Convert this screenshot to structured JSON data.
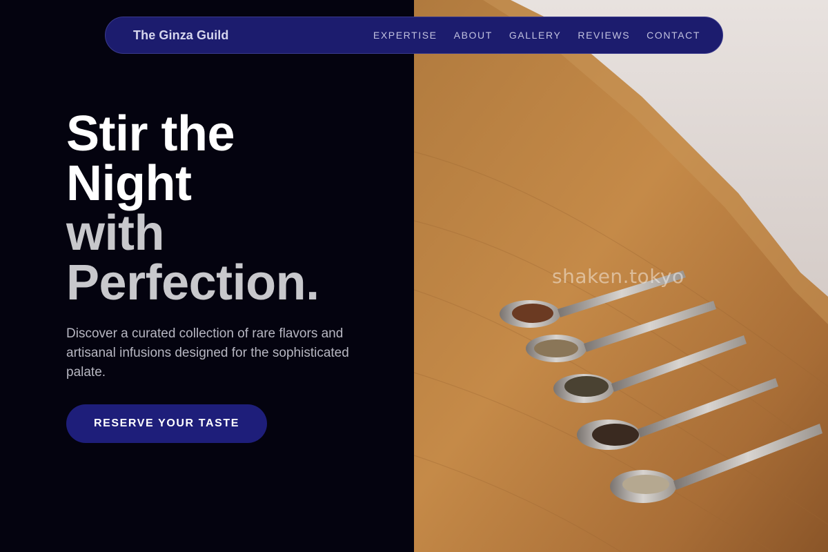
{
  "nav": {
    "brand": "The Ginza Guild",
    "links": [
      "EXPERTISE",
      "ABOUT",
      "GALLERY",
      "REVIEWS",
      "CONTACT"
    ]
  },
  "hero": {
    "title_line_1": "Stir the",
    "title_line_2": "Night",
    "title_line_3": "with",
    "title_line_4": "Perfection.",
    "subtitle": "Discover a curated collection of rare flavors and artisanal infusions designed for the sophisticated palate.",
    "cta_label": "RESERVE YOUR TASTE"
  },
  "photo": {
    "watermark": "shaken.tokyo",
    "subject": "five silver spoons with loose tea leaves on a wooden counter"
  },
  "colors": {
    "background": "#04030f",
    "nav_bg": "#1c1c6e",
    "accent": "#1e1e7a",
    "title_white": "#ffffff",
    "title_grey": "#c8c8cc"
  }
}
